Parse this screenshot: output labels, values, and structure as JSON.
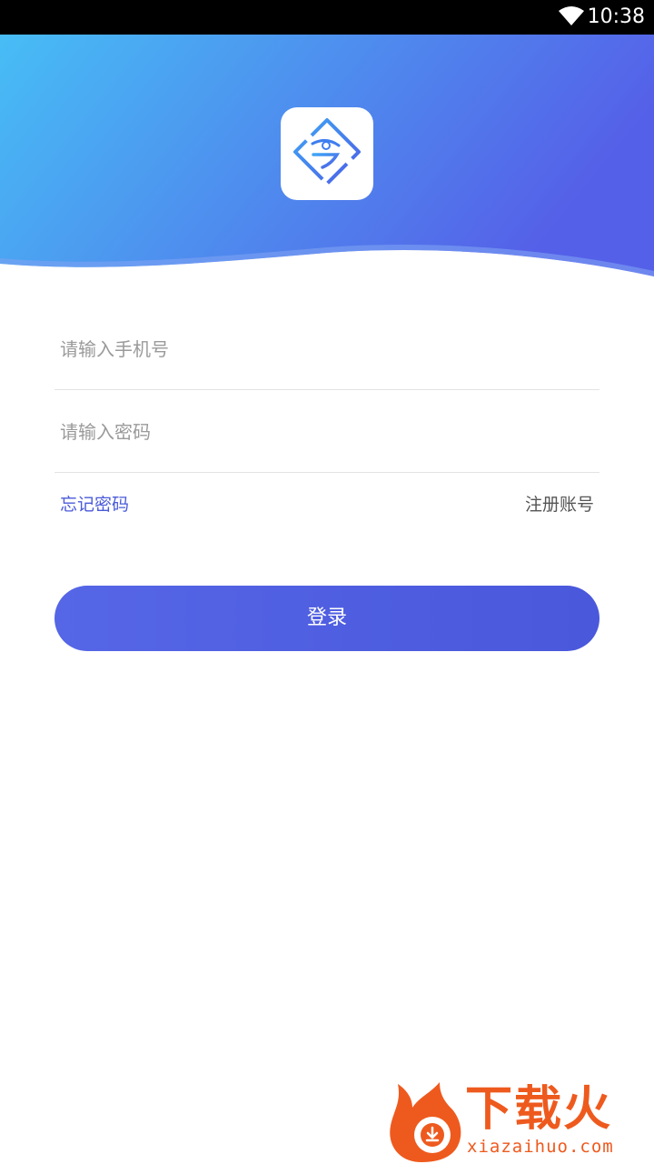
{
  "status_bar": {
    "time": "10:38",
    "wifi_icon": "wifi-icon"
  },
  "header": {
    "logo_icon": "app-logo-icon",
    "gradient_start": "#47bdf5",
    "gradient_end": "#5560e8"
  },
  "form": {
    "phone_placeholder": "请输入手机号",
    "phone_value": "",
    "password_placeholder": "请输入密码",
    "password_value": "",
    "forgot_label": "忘记密码",
    "register_label": "注册账号",
    "login_label": "登录"
  },
  "colors": {
    "accent": "#4a5bd9",
    "button": "#5262e2",
    "watermark": "#ee5a1e"
  },
  "watermark": {
    "title": "下载火",
    "subtitle": "xiazaihuo.com"
  }
}
